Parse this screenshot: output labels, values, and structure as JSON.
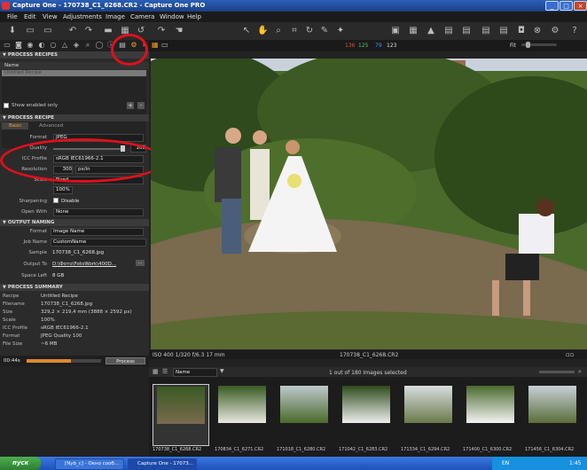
{
  "window": {
    "title": "Capture One - 170738_C1_6268.CR2 - Capture One PRO"
  },
  "menu": [
    "File",
    "Edit",
    "View",
    "Adjustments",
    "Image",
    "Camera",
    "Window",
    "Help"
  ],
  "viewer_bar": {
    "levels": [
      "136",
      "125",
      "79",
      "123"
    ],
    "fit_label": "Fit"
  },
  "process_recipes": {
    "header": "PROCESS RECIPES",
    "col_name": "Name",
    "items": [
      "Untitled Recipe"
    ],
    "show_enabled": "Show enabled only"
  },
  "process_recipe": {
    "header": "PROCESS RECIPE",
    "tabs": [
      "Basic",
      "Advanced"
    ],
    "format_label": "Format",
    "format": "JPEG",
    "quality_label": "Quality",
    "quality": "100",
    "icc_label": "ICC Profile",
    "icc": "sRGB IEC61966-2.1",
    "resolution_label": "Resolution",
    "resolution": "300",
    "resolution_unit": "px/in",
    "scale_label": "Scale",
    "scale": "Fixed",
    "scale_pct": "100%",
    "sharpening_label": "Sharpening",
    "sharpening": "Disable",
    "openwith_label": "Open With",
    "openwith": "None"
  },
  "output_naming": {
    "header": "OUTPUT NAMING",
    "format_label": "Format",
    "format": "Image Name",
    "jobname_label": "Job Name",
    "jobname": "CustomName",
    "sample_label": "Sample",
    "sample": "170738_C1_6268.jpg",
    "output_label": "Output To",
    "output": "D:\\Фото\\FotoWork\\400D...",
    "space_label": "Space Left",
    "space": "8 GB"
  },
  "process_summary": {
    "header": "PROCESS SUMMARY",
    "rows": [
      {
        "k": "Recipe",
        "v": "Untitled Recipe"
      },
      {
        "k": "Filename",
        "v": "170738_C1_6268.jpg"
      },
      {
        "k": "Size",
        "v": "329,2 × 219,4  mm  (3888 × 2592  px)"
      },
      {
        "k": "Scale",
        "v": "100%"
      },
      {
        "k": "ICC Profile",
        "v": "sRGB IEC61966-2.1"
      },
      {
        "k": "Format",
        "v": "JPEG Quality 100"
      },
      {
        "k": "File Size",
        "v": "~6 MB"
      }
    ]
  },
  "process_bar": {
    "time": "00:44s",
    "process_button": "Process",
    "progress": 0.6
  },
  "status": {
    "exif": "ISO 400   1/320   f/6.3   17 mm",
    "filename": "170738_C1_6268.CR2"
  },
  "browser": {
    "sort": "Name",
    "count": "1 out of 180 Images selected"
  },
  "filmstrip": [
    {
      "cap": "170738_C1_6268.CR2"
    },
    {
      "cap": "170834_C1_6271.CR2"
    },
    {
      "cap": "171018_C1_6280.CR2"
    },
    {
      "cap": "171042_C1_6283.CR2"
    },
    {
      "cap": "171334_C1_6294.CR2"
    },
    {
      "cap": "171400_C1_6300.CR2"
    },
    {
      "cap": "171456_C1_6304.CR2"
    }
  ],
  "taskbar": {
    "start": "пуск",
    "tasks": [
      "[Nyb_c] - Окно сооб...",
      "Capture One - 17073..."
    ],
    "lang": "EN",
    "clock": "1:45"
  },
  "colors": {
    "annotation": "#e0101a",
    "accent": "#f0a020"
  }
}
